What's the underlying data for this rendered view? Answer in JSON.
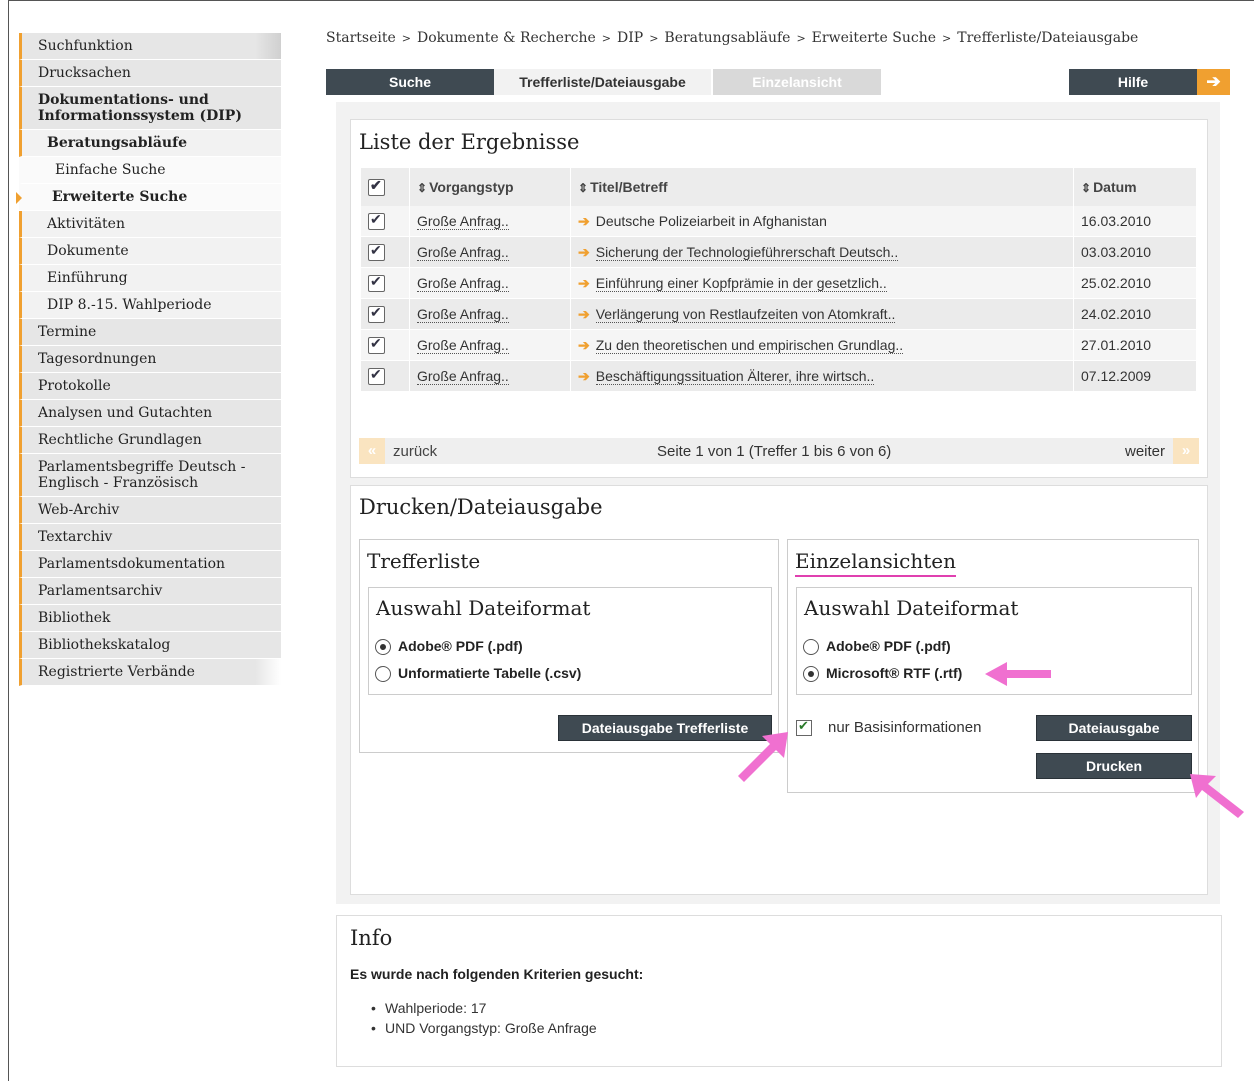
{
  "sidebar": {
    "items": [
      {
        "label": "Suchfunktion"
      },
      {
        "label": "Drucksachen"
      },
      {
        "label": "Dokumentations- und Informationssystem (DIP)"
      },
      {
        "label": "Beratungsabläufe"
      },
      {
        "label": "Einfache Suche"
      },
      {
        "label": "Erweiterte Suche"
      },
      {
        "label": "Aktivitäten"
      },
      {
        "label": "Dokumente"
      },
      {
        "label": "Einführung"
      },
      {
        "label": "DIP 8.-15. Wahlperiode"
      },
      {
        "label": "Termine"
      },
      {
        "label": "Tagesordnungen"
      },
      {
        "label": "Protokolle"
      },
      {
        "label": "Analysen und Gutachten"
      },
      {
        "label": "Rechtliche Grundlagen"
      },
      {
        "label": "Parlamentsbegriffe Deutsch - Englisch - Französisch"
      },
      {
        "label": "Web-Archiv"
      },
      {
        "label": "Textarchiv"
      },
      {
        "label": "Parlamentsdokumentation"
      },
      {
        "label": "Parlamentsarchiv"
      },
      {
        "label": "Bibliothek"
      },
      {
        "label": "Bibliothekskatalog"
      },
      {
        "label": "Registrierte Verbände"
      }
    ]
  },
  "breadcrumb": [
    "Startseite",
    "Dokumente & Recherche",
    "DIP",
    "Beratungsabläufe",
    "Erweiterte Suche",
    "Trefferliste/Dateiausgabe"
  ],
  "tabs": {
    "suche": "Suche",
    "treffer": "Trefferliste/Dateiausgabe",
    "einzel": "Einzelansicht",
    "hilfe": "Hilfe"
  },
  "results": {
    "title": "Liste der Ergebnisse",
    "columns": {
      "typ": "Vorgangstyp",
      "titel": "Titel/Betreff",
      "datum": "Datum"
    },
    "rows": [
      {
        "typ": "Große Anfrag..",
        "titel": "Deutsche Polizeiarbeit in Afghanistan",
        "datum": "16.03.2010"
      },
      {
        "typ": "Große Anfrag..",
        "titel": "Sicherung der Technologieführerschaft Deutsch..",
        "datum": "03.03.2010"
      },
      {
        "typ": "Große Anfrag..",
        "titel": "Einführung einer Kopfprämie in der gesetzlich..",
        "datum": "25.02.2010"
      },
      {
        "typ": "Große Anfrag..",
        "titel": "Verlängerung von Restlaufzeiten von Atomkraft..",
        "datum": "24.02.2010"
      },
      {
        "typ": "Große Anfrag..",
        "titel": "Zu den theoretischen und empirischen Grundlag..",
        "datum": "27.01.2010"
      },
      {
        "typ": "Große Anfrag..",
        "titel": "Beschäftigungssituation Älterer, ihre wirtsch..",
        "datum": "07.12.2009"
      }
    ],
    "pager": {
      "prev": "zurück",
      "status": "Seite 1 von 1 (Treffer 1 bis 6 von 6)",
      "next": "weiter"
    }
  },
  "print": {
    "title": "Drucken/Dateiausgabe",
    "left": {
      "title": "Trefferliste",
      "format_title": "Auswahl Dateiformat",
      "options": [
        "Adobe® PDF (.pdf)",
        "Unformatierte Tabelle (.csv)"
      ],
      "selected": 0,
      "button": "Dateiausgabe Trefferliste"
    },
    "right": {
      "title": "Einzelansichten",
      "format_title": "Auswahl Dateiformat",
      "options": [
        "Adobe® PDF (.pdf)",
        "Microsoft® RTF (.rtf)"
      ],
      "selected": 1,
      "checkbox_label": "nur Basisinformationen",
      "checkbox_checked": true,
      "button_file": "Dateiausgabe",
      "button_print": "Drucken"
    }
  },
  "info": {
    "title": "Info",
    "subtitle": "Es wurde nach folgenden Kriterien gesucht:",
    "criteria": [
      "Wahlperiode: 17",
      "UND Vorgangstyp: Große Anfrage"
    ]
  },
  "colors": {
    "accent": "#f0a030",
    "dark": "#3f4a52",
    "annotation": "#f070d0"
  }
}
